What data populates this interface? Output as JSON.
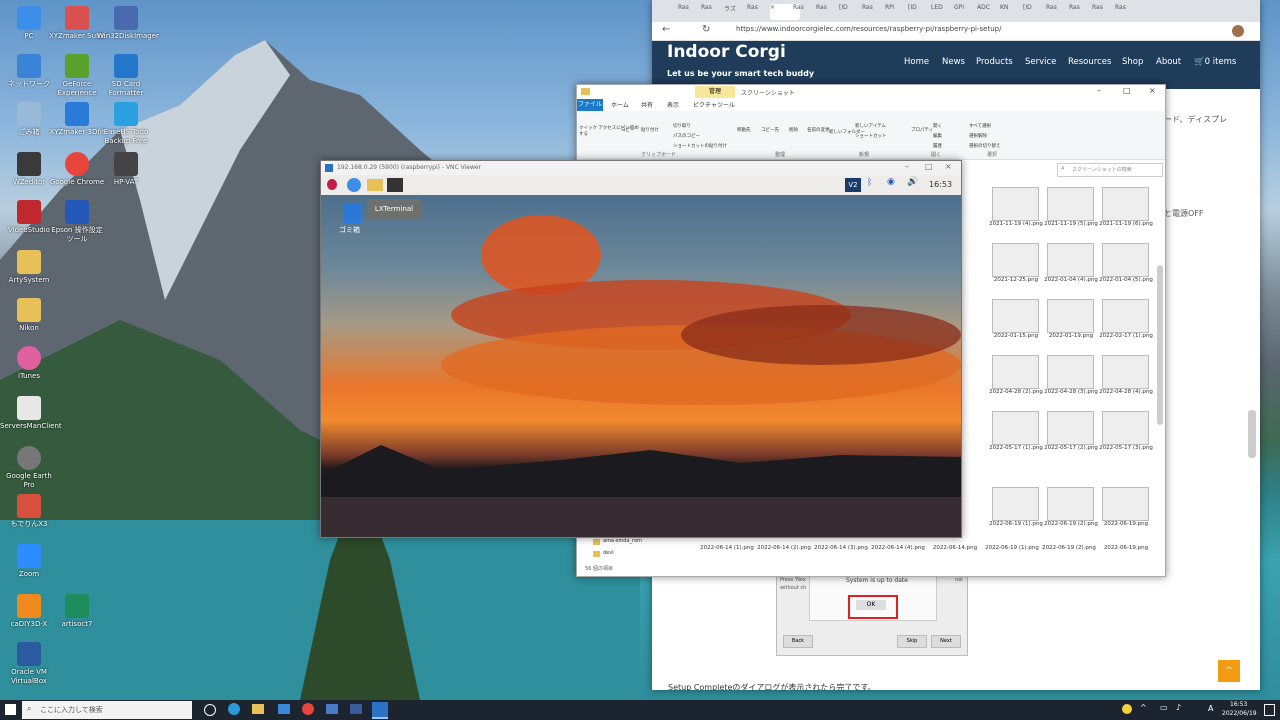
{
  "desktop_icons": [
    {
      "label": "PC",
      "color": "#3d8ee8"
    },
    {
      "label": "XYZmaker Suite",
      "color": "#d85050"
    },
    {
      "label": "Win32DiskImager",
      "color": "#4a6ab0"
    },
    {
      "label": "ネットワーク",
      "color": "#3a84d8"
    },
    {
      "label": "GeForce Experience",
      "color": "#5aa02c"
    },
    {
      "label": "SD Card Formatter",
      "color": "#2477c8"
    },
    {
      "label": "ごみ箱",
      "color": "#9ab8d8"
    },
    {
      "label": "XYZmaker 3Dfit",
      "color": "#2a7ad8"
    },
    {
      "label": "EaseUS Todo Backup Free",
      "color": "#2aa0e0"
    },
    {
      "label": "WZeditor",
      "color": "#3a3a3a"
    },
    {
      "label": "Google Chrome",
      "color": "#e8453c"
    },
    {
      "label": "HP-VAT",
      "color": "#444444"
    },
    {
      "label": "VideoStudio",
      "color": "#c0282e"
    },
    {
      "label": "Epson 操作設定ツール",
      "color": "#2458b8"
    },
    {
      "label": "ArtySystem",
      "color": "#e8c058"
    },
    {
      "label": "Nikon",
      "color": "#e8c058"
    },
    {
      "label": "iTunes",
      "color": "#e060a0"
    },
    {
      "label": "ServersManClient",
      "color": "#e8e8e8"
    },
    {
      "label": "Google Earth Pro",
      "color": "#777777"
    },
    {
      "label": "もでりんX3",
      "color": "#d8503c"
    },
    {
      "label": "Zoom",
      "color": "#2d8cff"
    },
    {
      "label": "caDIY3D-X",
      "color": "#f08a1c"
    },
    {
      "label": "artisoct7",
      "color": "#1c8c5c"
    },
    {
      "label": "Oracle VM VirtualBox",
      "color": "#2a5aa0"
    }
  ],
  "browser": {
    "url": "https://www.indoorcorgielec.com/resources/raspberry-pi/raspberry-pi-setup/",
    "brand": "Indoor Corgi",
    "tagline": "Let us be your smart tech buddy",
    "nav": [
      "Home",
      "News",
      "Products",
      "Service",
      "Resources",
      "Shop",
      "About",
      "0 items"
    ],
    "side_text_1": "ード、ディスプレ",
    "side_text_2": "と電源OFF",
    "bottom_text": "Setup Completeのダイアログが表示されたら完了です。",
    "tabs": [
      "Ras",
      "Ras",
      "ラズ",
      "Ras",
      "×",
      "Ras",
      "Ras",
      "[ID",
      "Ras",
      "RPi",
      "[ID",
      "LED",
      "GPI",
      "ADC",
      "KN",
      "[ID",
      "Ras",
      "Ras",
      "Ras",
      "Ras"
    ]
  },
  "explorer": {
    "title": "スクリーンショット",
    "manage_tab": "管理",
    "ribbon_tabs": [
      "ファイル",
      "ホーム",
      "共有",
      "表示",
      "ピクチャツール"
    ],
    "ribbon_buttons": [
      "クイック アクセスにピン留めする",
      "コピー",
      "貼り付け",
      "切り取り",
      "パスのコピー",
      "ショートカットの貼り付け",
      "移動先",
      "コピー先",
      "削除",
      "名前の変更",
      "新しいフォルダー",
      "新しいアイテム",
      "ショートカット",
      "プロパティ",
      "開く",
      "編集",
      "履歴",
      "すべて選択",
      "選択解除",
      "選択の切り替え"
    ],
    "groups": [
      "クリップボード",
      "整理",
      "新規",
      "開く",
      "選択"
    ],
    "search_placeholder": "スクリーンショットの検索",
    "status": "56 個の項目",
    "folders": [
      "ama-smda_rom",
      "devl"
    ],
    "files": [
      "2021-11-19 (4).png",
      "2021-11-19 (5).png",
      "2021-11-19 (6).png",
      "2021-12-25.png",
      "2022-01-04 (4).png",
      "2022-01-04 (5).png",
      "2022-01-15.png",
      "2022-01-19.png",
      "2022-02-17 (1).png",
      "2022-04-28 (2).png",
      "2022-04-28 (3).png",
      "2022-04-28 (4).png",
      "2022-05-17 (1).png",
      "2022-05-17 (2).png",
      "2022-05-17 (3).png",
      "2022-06-19 (1).png",
      "2022-06-19 (2).png",
      "2022-06-19.png"
    ],
    "bottom_files": [
      "2022-06-14 (1).png",
      "2022-06-14 (2).png",
      "2022-06-14 (3).png",
      "2022-06-14 (4).png",
      "2022-06-14.png",
      "2022-06-19 (1).png",
      "2022-06-19 (2).png",
      "2022-06-19.png"
    ]
  },
  "vnc": {
    "title": "192.168.0.29 (5900) (raspberrypi) - VNC Viewer",
    "desktop_icon_label": "ゴミ箱",
    "tooltip": "LXTerminal",
    "clock": "16:53",
    "vnc_badge": "V2"
  },
  "dialog": {
    "message": "System is up to date",
    "side_text_a": "Press 'Nex",
    "side_text_b": "without ch",
    "side_text_c": "nal",
    "ok": "OK",
    "back": "Back",
    "skip": "Skip",
    "next": "Next"
  },
  "taskbar": {
    "search_placeholder": "ここに入力して検索",
    "time": "16:53",
    "date": "2022/06/19",
    "ime": "A"
  }
}
